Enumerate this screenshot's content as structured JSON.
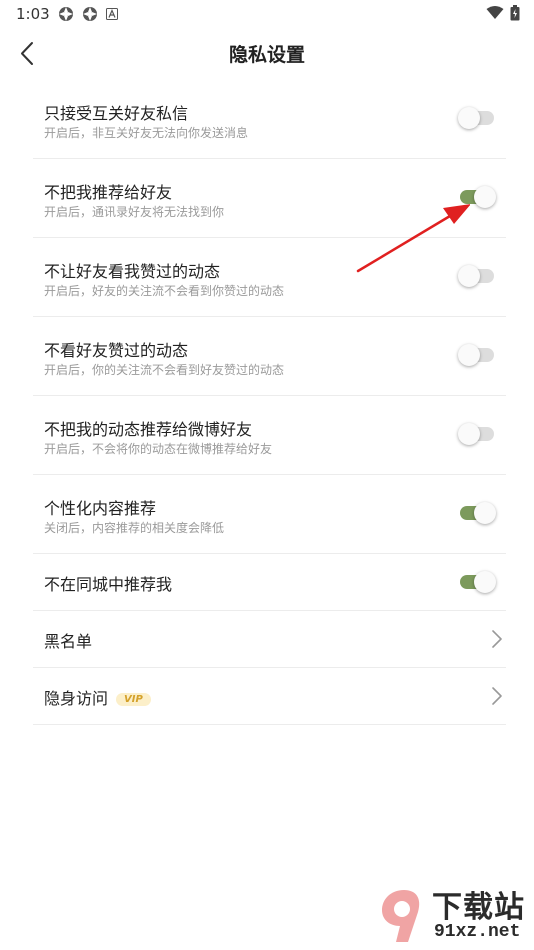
{
  "status_bar": {
    "time": "1:03"
  },
  "header": {
    "title": "隐私设置"
  },
  "settings": [
    {
      "title": "只接受互关好友私信",
      "subtitle": "开启后，非互关好友无法向你发送消息",
      "enabled": false
    },
    {
      "title": "不把我推荐给好友",
      "subtitle": "开启后，通讯录好友将无法找到你",
      "enabled": true
    },
    {
      "title": "不让好友看我赞过的动态",
      "subtitle": "开启后，好友的关注流不会看到你赞过的动态",
      "enabled": false
    },
    {
      "title": "不看好友赞过的动态",
      "subtitle": "开启后，你的关注流不会看到好友赞过的动态",
      "enabled": false
    },
    {
      "title": "不把我的动态推荐给微博好友",
      "subtitle": "开启后，不会将你的动态在微博推荐给好友",
      "enabled": false
    },
    {
      "title": "个性化内容推荐",
      "subtitle": "关闭后，内容推荐的相关度会降低",
      "enabled": true
    },
    {
      "title": "不在同城中推荐我",
      "enabled": true
    }
  ],
  "links": [
    {
      "title": "黑名单"
    },
    {
      "title": "隐身访问",
      "badge": "VIP"
    }
  ],
  "colors": {
    "toggle_on": "#7c9a5c",
    "toggle_off": "#dddddd",
    "annotation_arrow": "#e02020"
  },
  "watermark": {
    "brand": "下载站",
    "domain": "91xz.net"
  }
}
